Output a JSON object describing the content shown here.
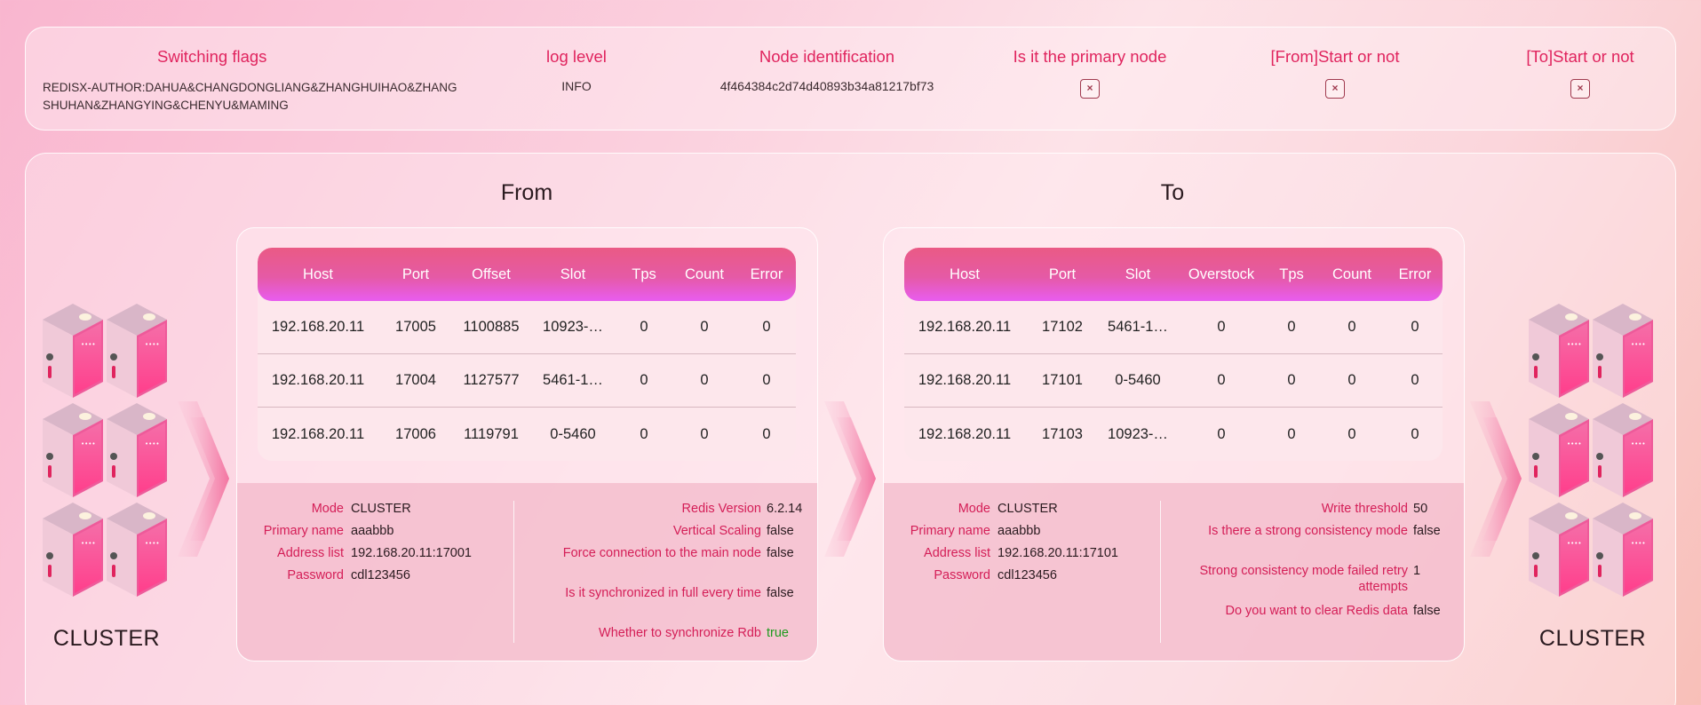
{
  "flags": {
    "switching_flags": {
      "label": "Switching flags",
      "value": "REDISX-AUTHOR:DAHUA&CHANGDONGLIANG&ZHANGHUIHAO&ZHANGSHUHAN&ZHANGYING&CHENYU&MAMING"
    },
    "log_level": {
      "label": "log level",
      "value": "INFO"
    },
    "node_id": {
      "label": "Node identification",
      "value": "4f464384c2d74d40893b34a81217bf73"
    },
    "primary_node": {
      "label": "Is it the primary node",
      "value": "×"
    },
    "from_start": {
      "label": "[From]Start or not",
      "value": "×"
    },
    "to_start": {
      "label": "[To]Start or not",
      "value": "×"
    }
  },
  "left_cluster": {
    "label": "CLUSTER"
  },
  "right_cluster": {
    "label": "CLUSTER"
  },
  "from": {
    "title": "From",
    "columns": [
      "Host",
      "Port",
      "Offset",
      "Slot",
      "Tps",
      "Count",
      "Error"
    ],
    "rows": [
      [
        "192.168.20.11",
        "17005",
        "1100885",
        "10923-…",
        "0",
        "0",
        "0"
      ],
      [
        "192.168.20.11",
        "17004",
        "1127577",
        "5461-1…",
        "0",
        "0",
        "0"
      ],
      [
        "192.168.20.11",
        "17006",
        "1119791",
        "0-5460",
        "0",
        "0",
        "0"
      ]
    ],
    "info_left": [
      {
        "k": "Mode",
        "v": "CLUSTER"
      },
      {
        "k": "Primary name",
        "v": "aaabbb"
      },
      {
        "k": "Address list",
        "v": "192.168.20.11:17001"
      },
      {
        "k": "Password",
        "v": "cdl123456"
      }
    ],
    "info_right": [
      {
        "k": "Redis Version",
        "v": "6.2.14"
      },
      {
        "k": "Vertical Scaling",
        "v": "false"
      },
      {
        "k": "Force connection to the main node",
        "v": "false"
      },
      {
        "k": "Is it synchronized in full every time",
        "v": "false"
      },
      {
        "k": "Whether to synchronize Rdb",
        "v": "true"
      }
    ]
  },
  "to": {
    "title": "To",
    "columns": [
      "Host",
      "Port",
      "Slot",
      "Overstock",
      "Tps",
      "Count",
      "Error"
    ],
    "rows": [
      [
        "192.168.20.11",
        "17102",
        "5461-1…",
        "0",
        "0",
        "0",
        "0"
      ],
      [
        "192.168.20.11",
        "17101",
        "0-5460",
        "0",
        "0",
        "0",
        "0"
      ],
      [
        "192.168.20.11",
        "17103",
        "10923-…",
        "0",
        "0",
        "0",
        "0"
      ]
    ],
    "info_left": [
      {
        "k": "Mode",
        "v": "CLUSTER"
      },
      {
        "k": "Primary name",
        "v": "aaabbb"
      },
      {
        "k": "Address list",
        "v": "192.168.20.11:17101"
      },
      {
        "k": "Password",
        "v": "cdl123456"
      }
    ],
    "info_right": [
      {
        "k": "Write threshold",
        "v": "50"
      },
      {
        "k": "Is there a strong consistency mode",
        "v": "false"
      },
      {
        "k": "Strong consistency mode failed retry attempts",
        "v": "1"
      },
      {
        "k": "Do you want to clear Redis data",
        "v": "false"
      }
    ]
  },
  "colors": {
    "accent": "#e0245e",
    "true_value": "#1e9a1e",
    "header_start": "#ea5a85",
    "header_end": "#e85cf0"
  },
  "icons": [
    "server-icon",
    "chevron-right-icon",
    "close-icon"
  ]
}
